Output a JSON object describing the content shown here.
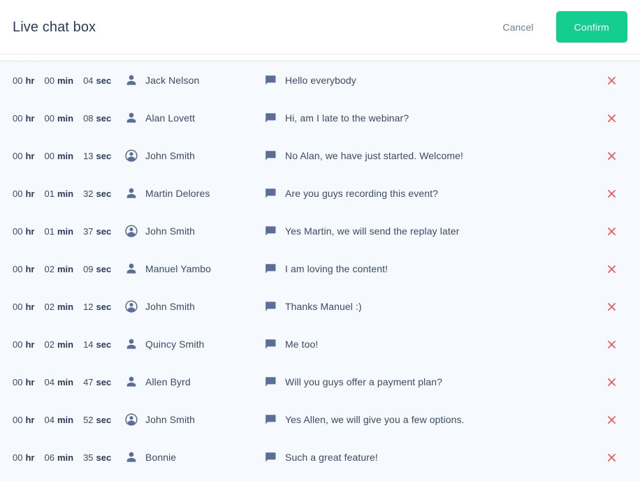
{
  "header": {
    "title": "Live chat box",
    "cancel_label": "Cancel",
    "confirm_label": "Confirm",
    "confirm_color": "#14ce8f",
    "cancel_color": "#6f7d9b",
    "title_color": "#2b3a5c"
  },
  "list": {
    "background_color": "#f6f9fe",
    "icon_color": "#5b6d99",
    "text_color": "#3c4a68",
    "delete_icon_color": "#f05a5a",
    "delete_icon_name": "close-icon",
    "chat_icon_name": "chat-bubble-icon",
    "units": {
      "hr": "hr",
      "min": "min",
      "sec": "sec"
    },
    "rows": [
      {
        "hr": "00",
        "min": "00",
        "sec": "04",
        "user": "Jack Nelson",
        "icon": "person-icon",
        "message": "Hello everybody"
      },
      {
        "hr": "00",
        "min": "00",
        "sec": "08",
        "user": "Alan Lovett",
        "icon": "person-icon",
        "message": "Hi, am I late to the webinar?"
      },
      {
        "hr": "00",
        "min": "00",
        "sec": "13",
        "user": "John Smith",
        "icon": "account-circle-icon",
        "message": "No Alan, we have just started. Welcome!"
      },
      {
        "hr": "00",
        "min": "01",
        "sec": "32",
        "user": "Martin Delores",
        "icon": "person-icon",
        "message": "Are you guys recording this event?"
      },
      {
        "hr": "00",
        "min": "01",
        "sec": "37",
        "user": "John Smith",
        "icon": "account-circle-icon",
        "message": "Yes Martin, we will send the replay later"
      },
      {
        "hr": "00",
        "min": "02",
        "sec": "09",
        "user": "Manuel Yambo",
        "icon": "person-icon",
        "message": "I am loving the content!"
      },
      {
        "hr": "00",
        "min": "02",
        "sec": "12",
        "user": "John Smith",
        "icon": "account-circle-icon",
        "message": "Thanks Manuel :)"
      },
      {
        "hr": "00",
        "min": "02",
        "sec": "14",
        "user": "Quincy Smith",
        "icon": "person-icon",
        "message": "Me too!"
      },
      {
        "hr": "00",
        "min": "04",
        "sec": "47",
        "user": "Allen Byrd",
        "icon": "person-icon",
        "message": "Will you guys offer a payment plan?"
      },
      {
        "hr": "00",
        "min": "04",
        "sec": "52",
        "user": "John Smith",
        "icon": "account-circle-icon",
        "message": "Yes Allen, we will give you a few options."
      },
      {
        "hr": "00",
        "min": "06",
        "sec": "35",
        "user": "Bonnie",
        "icon": "person-icon",
        "message": "Such a great feature!"
      }
    ]
  }
}
